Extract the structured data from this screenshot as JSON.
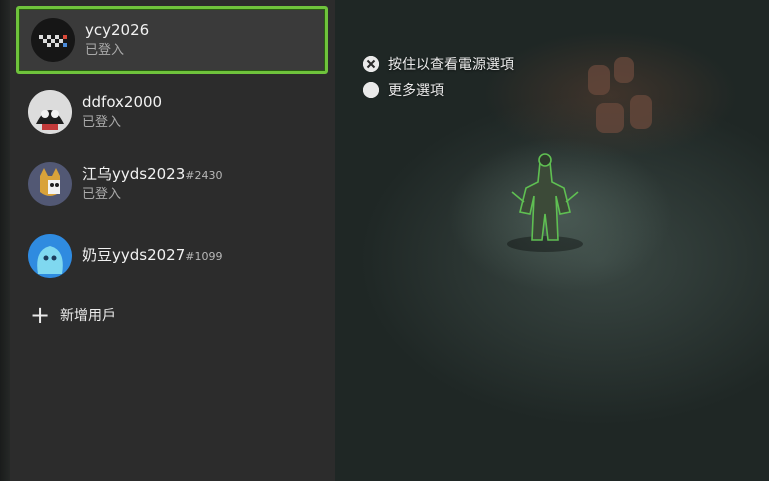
{
  "accounts": [
    {
      "gamertag": "ycy2026",
      "suffix": "",
      "status": "已登入",
      "selected": true,
      "avatar": "checkered-ring-avatar"
    },
    {
      "gamertag": "ddfox2000",
      "suffix": "",
      "status": "已登入",
      "selected": false,
      "avatar": "skull-avatar"
    },
    {
      "gamertag": "江乌yyds2023",
      "suffix": "#2430",
      "status": "已登入",
      "selected": false,
      "avatar": "cat-skull-avatar"
    },
    {
      "gamertag": "奶豆yyds2027",
      "suffix": "#1099",
      "status": "",
      "selected": false,
      "avatar": "blue-blob-avatar"
    }
  ],
  "add_user": {
    "icon": "plus-icon",
    "label": "新增用戶"
  },
  "hints": [
    {
      "icon": "xbox-button-icon",
      "label": "按住以查看電源選項"
    },
    {
      "icon": "menu-button-icon",
      "label": "更多選項"
    }
  ],
  "colors": {
    "selection": "#6fc33c",
    "panel": "#2c2c2c"
  }
}
